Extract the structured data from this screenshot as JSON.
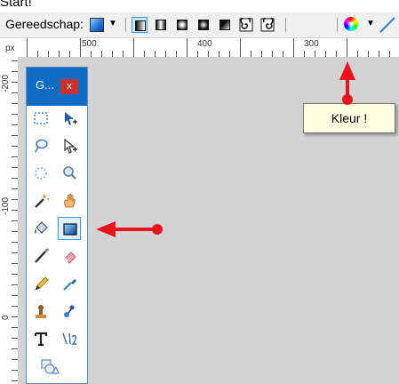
{
  "caption": "Start!",
  "toolbar": {
    "tool_label": "Gereedschap:",
    "gradient_buttons": [
      "linear-gradient-icon",
      "reflected-gradient-icon",
      "diamond-gradient-icon",
      "radial-gradient-icon",
      "conical-gradient-icon",
      "spiral-cw-gradient-icon",
      "spiral-ccw-gradient-icon"
    ],
    "selected_gradient_index": 0
  },
  "ruler": {
    "unit": "px",
    "top_labels": [
      "500",
      "400",
      "300"
    ],
    "left_labels": [
      "-200",
      "-100",
      "0"
    ]
  },
  "tools_window": {
    "title": "G...",
    "close": "x",
    "tools": [
      [
        "rectangle-select-icon",
        "move-selection-icon"
      ],
      [
        "lasso-select-icon",
        "move-selected-icon"
      ],
      [
        "ellipse-select-icon",
        "zoom-icon"
      ],
      [
        "magic-wand-icon",
        "pan-icon"
      ],
      [
        "paint-bucket-icon",
        "gradient-icon"
      ],
      [
        "paintbrush-icon",
        "eraser-icon"
      ],
      [
        "pencil-icon",
        "color-picker-icon"
      ],
      [
        "clone-stamp-icon",
        "recolor-icon"
      ],
      [
        "text-icon",
        "line-curve-icon"
      ],
      [
        "shapes-icon",
        ""
      ]
    ],
    "selected_tool": "gradient-icon"
  },
  "tooltip": {
    "text": "Kleur !"
  },
  "colors": {
    "title_bar": "#0e6cc4",
    "close": "#c7322b",
    "canvas": "#d3d3d3",
    "arrow": "#e8131b"
  }
}
